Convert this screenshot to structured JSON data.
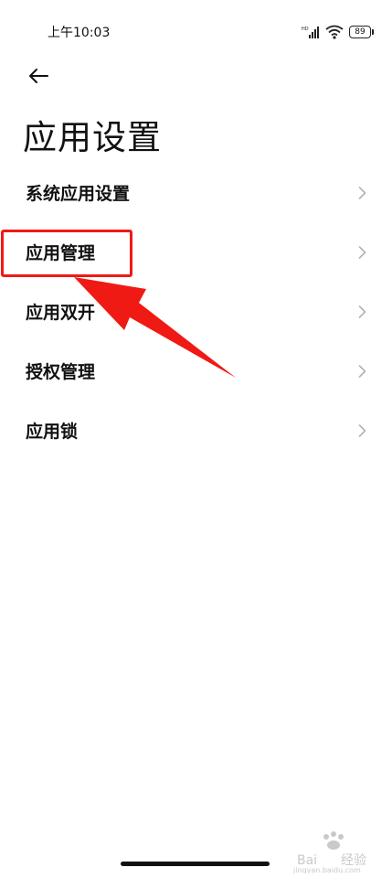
{
  "status_bar": {
    "time": "上午10:03",
    "battery": "89"
  },
  "header": {
    "title": "应用设置"
  },
  "menu": {
    "items": [
      {
        "label": "系统应用设置"
      },
      {
        "label": "应用管理"
      },
      {
        "label": "应用双开"
      },
      {
        "label": "授权管理"
      },
      {
        "label": "应用锁"
      }
    ]
  },
  "annotation": {
    "color": "#f01a14"
  },
  "icons": {
    "back": "arrow-left-icon",
    "chevron": "chevron-right-icon",
    "signal": "signal-icon",
    "wifi": "wifi-icon"
  }
}
